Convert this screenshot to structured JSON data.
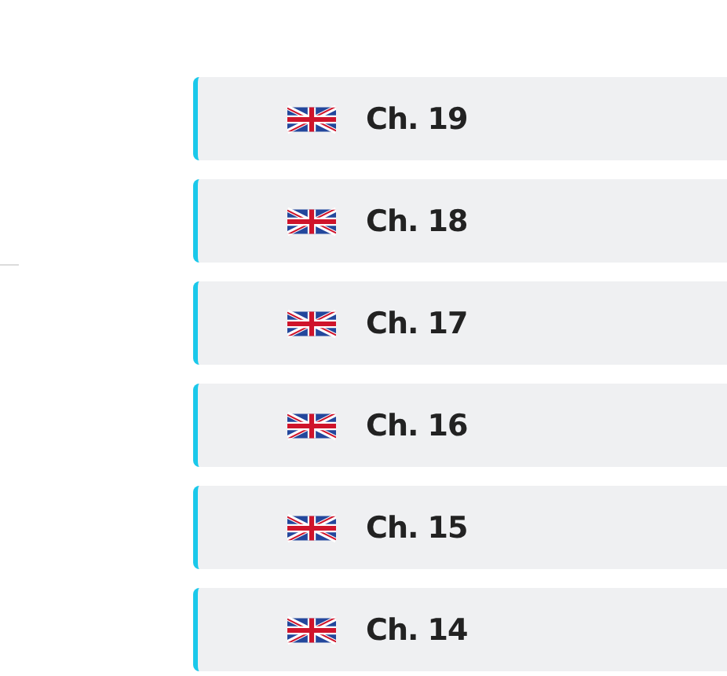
{
  "chapters": [
    {
      "label": "Ch. 19"
    },
    {
      "label": "Ch. 18"
    },
    {
      "label": "Ch. 17"
    },
    {
      "label": "Ch. 16"
    },
    {
      "label": "Ch. 15"
    },
    {
      "label": "Ch. 14"
    }
  ]
}
